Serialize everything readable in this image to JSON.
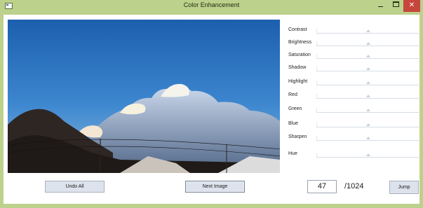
{
  "window": {
    "title": "Color Enhancement",
    "colors": {
      "frame": "#bcd18b",
      "close": "#c7463c"
    }
  },
  "sliders": [
    {
      "label": "Contrast",
      "value": 0.5
    },
    {
      "label": "Brightness",
      "value": 0.5
    },
    {
      "label": "Saturation",
      "value": 0.5
    },
    {
      "label": "Shadow",
      "value": 0.5
    },
    {
      "label": "Highlight",
      "value": 0.5
    },
    {
      "label": "Red",
      "value": 0.5
    },
    {
      "label": "Green",
      "value": 0.5
    },
    {
      "label": "Blue",
      "value": 0.5
    },
    {
      "label": "Sharpen",
      "value": 0.5
    },
    {
      "label": "Hue",
      "value": 0.5
    }
  ],
  "buttons": {
    "undo_all": "Undo All",
    "next_image": "Next Image",
    "jump": "Jump"
  },
  "navigation": {
    "current_index": "47",
    "total": "/1024"
  }
}
